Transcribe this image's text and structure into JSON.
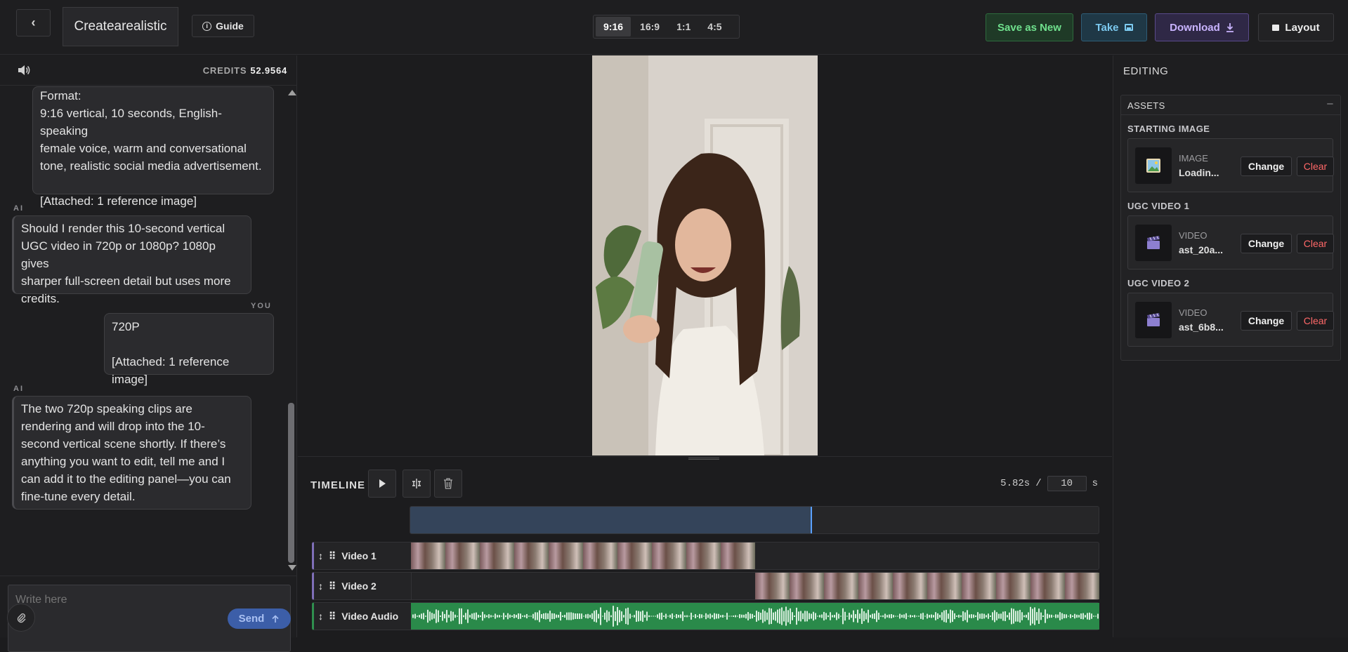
{
  "header": {
    "back_glyph": "‹",
    "project_title": "Createarealistic",
    "guide_label": "Guide",
    "guide_icon_glyph": "i",
    "ratios": [
      {
        "label": "9:16",
        "active": true
      },
      {
        "label": "16:9",
        "active": false
      },
      {
        "label": "1:1",
        "active": false
      },
      {
        "label": "4:5",
        "active": false
      }
    ],
    "save_new_label": "Save as New",
    "take_label": "Take",
    "download_label": "Download",
    "layout_label": "Layout"
  },
  "chat": {
    "credits_label": "CREDITS",
    "credits_value": "52.9564",
    "messages": [
      {
        "role": "",
        "text": "Format:\n9:16 vertical, 10 seconds, English-speaking\nfemale voice, warm and conversational\ntone, realistic social media advertisement.\n\n[Attached: 1 reference image]"
      },
      {
        "role": "AI",
        "text": "Should I render this 10-second vertical\nUGC video in 720p or 1080p? 1080p gives\nsharper full-screen detail but uses more\ncredits."
      },
      {
        "role": "YOU",
        "text": "720P\n\n[Attached: 1 reference image]"
      },
      {
        "role": "AI",
        "text": "The two 720p speaking clips are\nrendering and will drop into the 10-\nsecond vertical scene shortly. If there’s\nanything you want to edit, tell me and I\ncan add it to the editing panel—you can\nfine-tune every detail."
      }
    ],
    "input_placeholder": "Write here",
    "send_label": "Send"
  },
  "timeline": {
    "label": "TIMELINE",
    "current_time": "5.82s",
    "separator": "/",
    "duration": "10",
    "unit": "s",
    "progress_fraction": 0.582,
    "tracks": [
      {
        "name": "Video 1",
        "clip_start": 0.0,
        "clip_end": 0.5
      },
      {
        "name": "Video 2",
        "clip_start": 0.5,
        "clip_end": 1.0
      },
      {
        "name": "Video Audio",
        "clip_start": 0.0,
        "clip_end": 1.0
      }
    ]
  },
  "editing": {
    "title": "EDITING",
    "assets_title": "ASSETS",
    "collapse_glyph": "–",
    "sections": [
      {
        "title": "STARTING IMAGE",
        "kind": "IMAGE",
        "name": "Loadin...",
        "icon": "picture-icon",
        "change": "Change",
        "clear": "Clear"
      },
      {
        "title": "UGC VIDEO 1",
        "kind": "VIDEO",
        "name": "ast_20a...",
        "icon": "clapperboard-icon",
        "change": "Change",
        "clear": "Clear"
      },
      {
        "title": "UGC VIDEO 2",
        "kind": "VIDEO",
        "name": "ast_6b8...",
        "icon": "clapperboard-icon",
        "change": "Change",
        "clear": "Clear"
      }
    ]
  },
  "colors": {
    "accent_green": "#6fe08d",
    "accent_blue": "#7ccaf0",
    "accent_purple": "#c9b4ff",
    "clear_red": "#ff6868",
    "playhead": "#5aa0ff"
  }
}
